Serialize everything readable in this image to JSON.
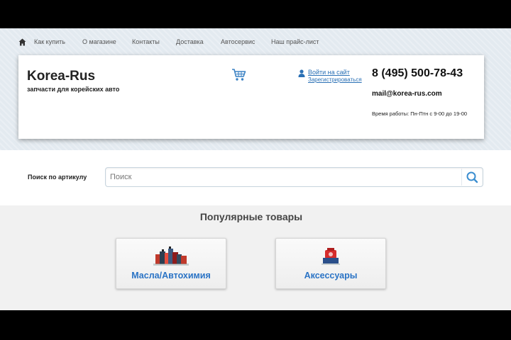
{
  "nav": {
    "items": [
      "Как купить",
      "О магазине",
      "Контакты",
      "Доставка",
      "Автосервис",
      "Наш прайс-лист"
    ]
  },
  "header": {
    "brand": "Korea-Rus",
    "tagline": "запчасти для корейских авто",
    "login": "Войти на сайт",
    "register": "Зарегистрироваться",
    "phone": "8 (495) 500-78-43",
    "email": "mail@korea-rus.com",
    "hours": "Время работы: Пн-Птн с 9-00 до 19-00"
  },
  "search": {
    "label": "Поиск по артикулу",
    "placeholder": "Поиск"
  },
  "popular": {
    "title": "Популярные товары",
    "categories": [
      {
        "label": "Масла/Автохимия",
        "icon": "oil-products-icon"
      },
      {
        "label": "Аксессуары",
        "icon": "accessories-icon"
      }
    ]
  },
  "colors": {
    "link": "#2a70b5",
    "category_text": "#2a73c5",
    "background": "#e3eaf0"
  }
}
